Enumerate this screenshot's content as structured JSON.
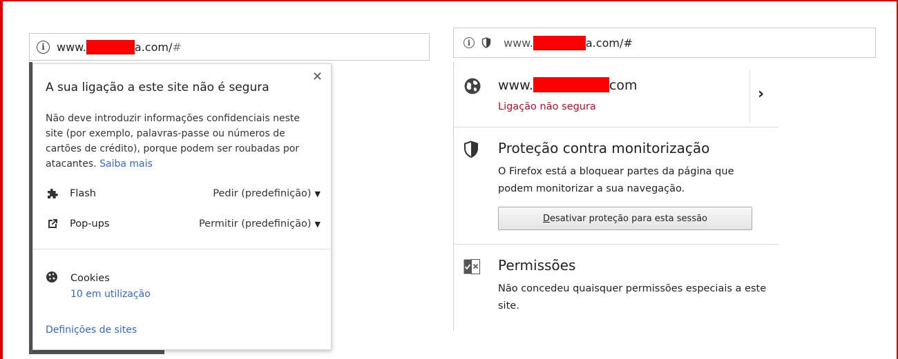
{
  "colors": {
    "frame": "#e00000",
    "redaction": "#ff0000",
    "link": "#3367d6",
    "insecure_status": "#d70022"
  },
  "chrome": {
    "url": {
      "prefix": "www.",
      "suffix": "a.com/",
      "hash": "#"
    },
    "popup": {
      "close_icon": "✕",
      "title": "A sua ligação a este site não é segura",
      "description": "Não deve introduzir informações confidenciais neste site (por exemplo, palavras-passe ou números de cartões de crédito), porque podem ser roubadas por atacantes.",
      "learn_more": "Saiba mais",
      "permissions": [
        {
          "icon": "puzzle-icon",
          "label": "Flash",
          "value": "Pedir (predefinição)"
        },
        {
          "icon": "external-link-icon",
          "label": "Pop-ups",
          "value": "Permitir (predefinição)"
        }
      ],
      "cookies": {
        "icon": "cookie-icon",
        "label": "Cookies",
        "count": "10 em utilização"
      },
      "site_settings": "Definições de sites"
    }
  },
  "firefox": {
    "url": {
      "prefix": "www.",
      "suffix": "a.com/#"
    },
    "site": {
      "icon": "globe-icon",
      "host_prefix": "www.",
      "host_suffix": "com",
      "status": "Ligação não segura"
    },
    "tracking_protection": {
      "icon": "shield-icon",
      "title": "Proteção contra monitorização",
      "description": "O Firefox está a bloquear partes da página que podem monitorizar a sua navegação.",
      "button_underlined": "D",
      "button_rest": "esativar proteção para esta sessão"
    },
    "permissions": {
      "icon": "permissions-icon",
      "title": "Permissões",
      "description": "Não concedeu quaisquer permissões especiais a este site."
    }
  }
}
